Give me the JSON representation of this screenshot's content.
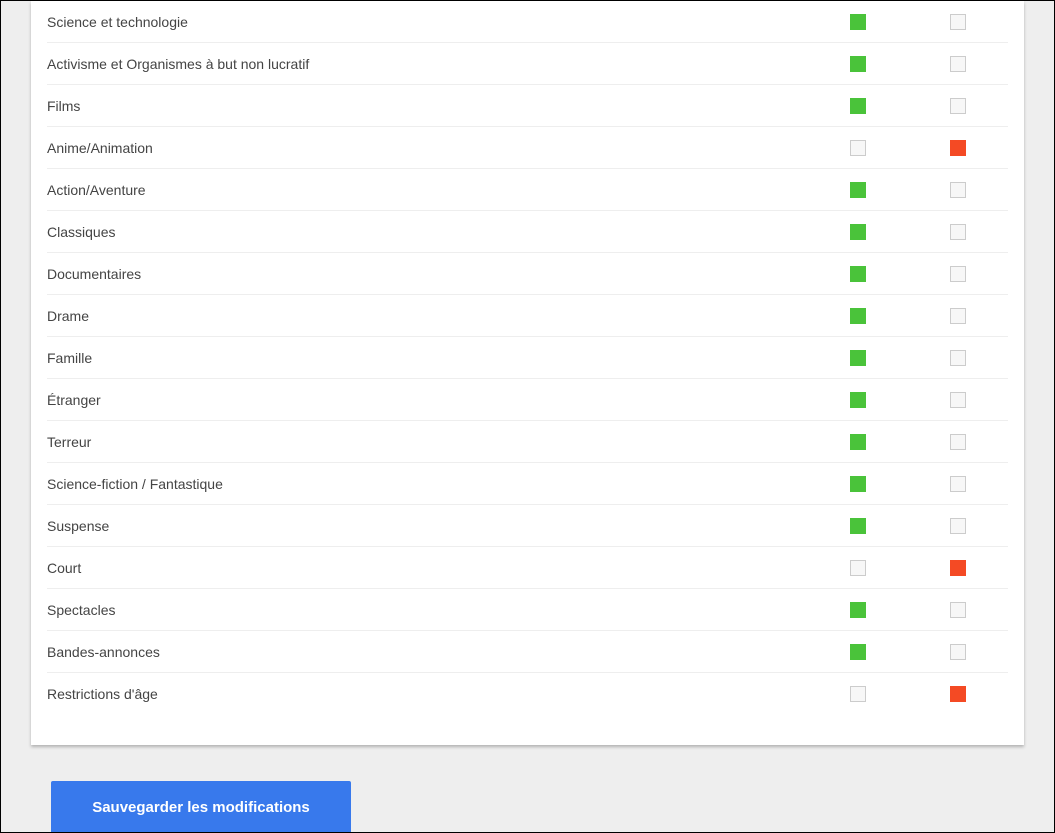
{
  "categories": [
    {
      "label": "Science et technologie",
      "allow": "green",
      "deny": "blank"
    },
    {
      "label": "Activisme et Organismes à but non lucratif",
      "allow": "green",
      "deny": "blank"
    },
    {
      "label": "Films",
      "allow": "green",
      "deny": "blank"
    },
    {
      "label": "Anime/Animation",
      "allow": "blank",
      "deny": "red"
    },
    {
      "label": "Action/Aventure",
      "allow": "green",
      "deny": "blank"
    },
    {
      "label": "Classiques",
      "allow": "green",
      "deny": "blank"
    },
    {
      "label": "Documentaires",
      "allow": "green",
      "deny": "blank"
    },
    {
      "label": "Drame",
      "allow": "green",
      "deny": "blank"
    },
    {
      "label": "Famille",
      "allow": "green",
      "deny": "blank"
    },
    {
      "label": "Étranger",
      "allow": "green",
      "deny": "blank"
    },
    {
      "label": "Terreur",
      "allow": "green",
      "deny": "blank"
    },
    {
      "label": "Science-fiction / Fantastique",
      "allow": "green",
      "deny": "blank"
    },
    {
      "label": "Suspense",
      "allow": "green",
      "deny": "blank"
    },
    {
      "label": "Court",
      "allow": "blank",
      "deny": "red"
    },
    {
      "label": "Spectacles",
      "allow": "green",
      "deny": "blank"
    },
    {
      "label": "Bandes-annonces",
      "allow": "green",
      "deny": "blank"
    },
    {
      "label": "Restrictions d'âge",
      "allow": "blank",
      "deny": "red"
    }
  ],
  "save_button_label": "Sauvegarder les modifications",
  "colors": {
    "green": "#4ac33a",
    "red": "#f44a24",
    "accent": "#3879ec"
  }
}
